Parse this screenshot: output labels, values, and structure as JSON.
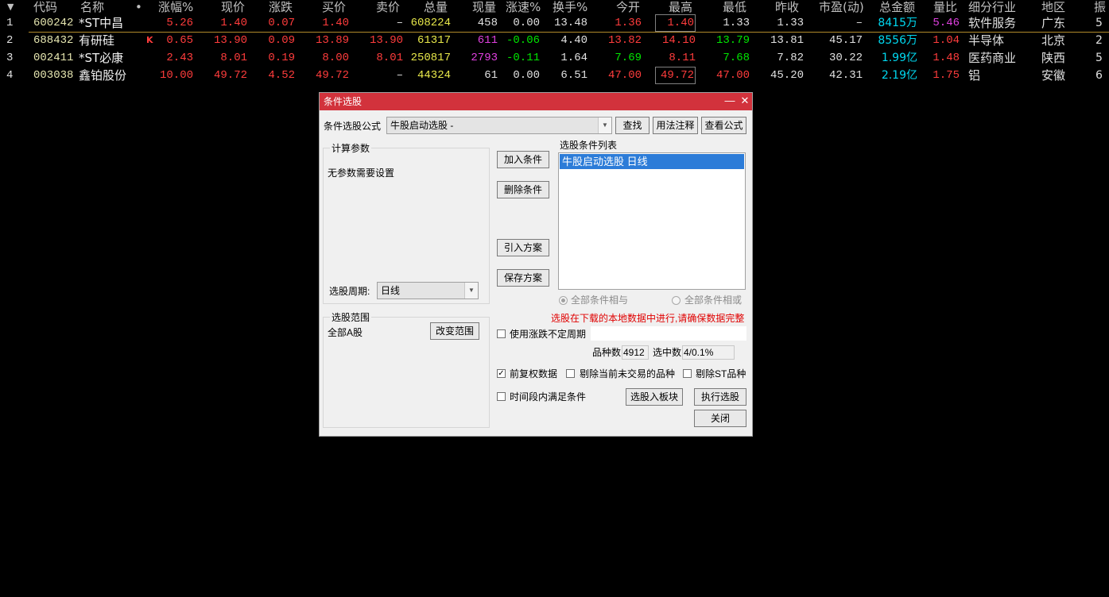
{
  "quote_table": {
    "sort_icon": "triangle-down-icon",
    "headers": [
      "代码",
      "名称",
      "•",
      "涨幅%",
      "现价",
      "涨跌",
      "买价",
      "卖价",
      "总量",
      "现量",
      "涨速%",
      "换手%",
      "今开",
      "最高",
      "最低",
      "昨收",
      "市盈(动)",
      "总金额",
      "量比",
      "细分行业",
      "地区",
      "振"
    ],
    "rows": [
      {
        "idx": "1",
        "code": "600242",
        "name": "*ST中昌",
        "mark": "",
        "pct": "5.26",
        "price": "1.40",
        "chg": "0.07",
        "bid": "1.40",
        "ask": "–",
        "vol": "608224",
        "cur": "458",
        "speed": "0.00",
        "turn": "13.48",
        "open": "1.36",
        "high": "1.40",
        "low": "1.33",
        "prev": "1.33",
        "pe": "–",
        "amt": "8415万",
        "vr": "5.46",
        "ind": "软件服务",
        "region": "广东",
        "amp": "5"
      },
      {
        "idx": "2",
        "code": "688432",
        "name": "有研硅",
        "mark": "K",
        "pct": "0.65",
        "price": "13.90",
        "chg": "0.09",
        "bid": "13.89",
        "ask": "13.90",
        "vol": "61317",
        "cur": "611",
        "speed": "-0.06",
        "turn": "4.40",
        "open": "13.82",
        "high": "14.10",
        "low": "13.79",
        "prev": "13.81",
        "pe": "45.17",
        "amt": "8556万",
        "vr": "1.04",
        "ind": "半导体",
        "region": "北京",
        "amp": "2"
      },
      {
        "idx": "3",
        "code": "002411",
        "name": "*ST必康",
        "mark": "",
        "pct": "2.43",
        "price": "8.01",
        "chg": "0.19",
        "bid": "8.00",
        "ask": "8.01",
        "vol": "250817",
        "cur": "2793",
        "speed": "-0.11",
        "turn": "1.64",
        "open": "7.69",
        "high": "8.11",
        "low": "7.68",
        "prev": "7.82",
        "pe": "30.22",
        "amt": "1.99亿",
        "vr": "1.48",
        "ind": "医药商业",
        "region": "陕西",
        "amp": "5"
      },
      {
        "idx": "4",
        "code": "003038",
        "name": "鑫铂股份",
        "mark": "",
        "pct": "10.00",
        "price": "49.72",
        "chg": "4.52",
        "bid": "49.72",
        "ask": "–",
        "vol": "44324",
        "cur": "61",
        "speed": "0.00",
        "turn": "6.51",
        "open": "47.00",
        "high": "49.72",
        "low": "47.00",
        "prev": "45.20",
        "pe": "42.31",
        "amt": "2.19亿",
        "vr": "1.75",
        "ind": "铝",
        "region": "安徽",
        "amp": "6"
      }
    ]
  },
  "dialog": {
    "title": "条件选股",
    "minimize_icon": "minimize-icon",
    "close_icon": "close-icon",
    "formula_label": "条件选股公式",
    "formula_value": "牛股启动选股 -",
    "find_button": "查找",
    "usage_button": "用法注释",
    "view_formula_button": "查看公式",
    "params_group": "计算参数",
    "params_text": "无参数需要设置",
    "period_label": "选股周期:",
    "period_value": "日线",
    "add_condition": "加入条件",
    "delete_condition": "删除条件",
    "import_plan": "引入方案",
    "save_plan": "保存方案",
    "conditions_label": "选股条件列表",
    "conditions": [
      "牛股启动选股  日线"
    ],
    "radio_and": "全部条件相与",
    "radio_or": "全部条件相或",
    "warning": "选股在下载的本地数据中进行,请确保数据完整",
    "range_group": "选股范围",
    "range_value": "全部A股",
    "change_range": "改变范围",
    "use_uncertain_period": "使用涨跌不定周期",
    "varieties_label": "品种数",
    "varieties_value": "4912",
    "selected_label": "选中数",
    "selected_value": "4/0.1%",
    "adjusted_data": "前复权数据",
    "exclude_untraded": "剔除当前未交易的品种",
    "exclude_st": "剔除ST品种",
    "time_period": "时间段内满足条件",
    "to_block": "选股入板块",
    "execute": "执行选股",
    "close": "关闭"
  },
  "colors": {
    "up": "#ff3c3c",
    "down": "#00e600",
    "yellow": "#e8e84a",
    "magenta": "#e040e0",
    "cyan": "#00d8f0",
    "code": "#e6e6b0",
    "dialog_title": "#d2323c",
    "warning": "#e00000",
    "selection": "#2c7cd8"
  }
}
